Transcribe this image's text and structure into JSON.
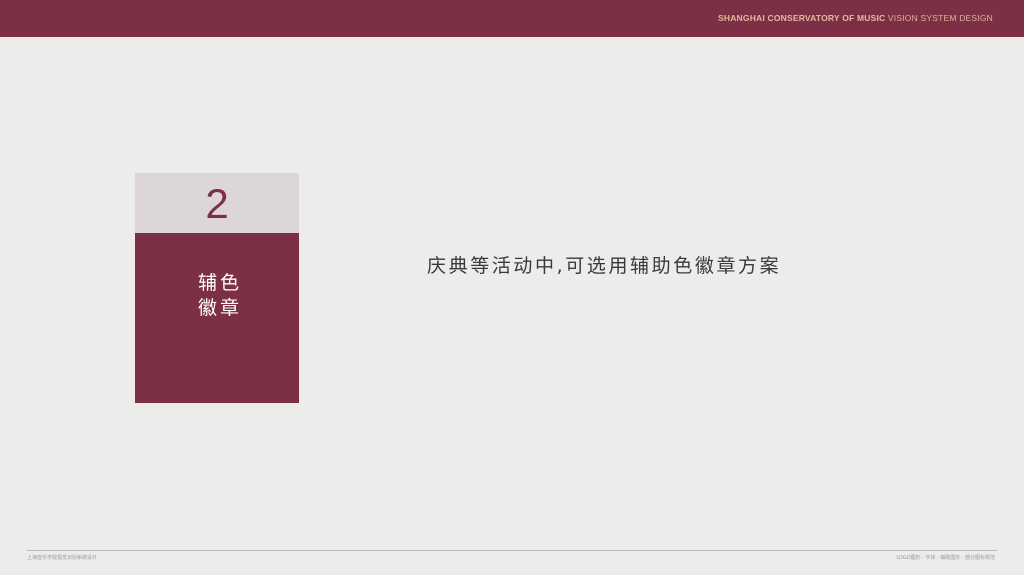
{
  "header": {
    "brand_primary": "SHANGHAI CONSERVATORY OF MUSIC",
    "brand_secondary": "VISION SYSTEM DESIGN"
  },
  "section": {
    "number": "2",
    "title_line1": "辅色",
    "title_line2": "徽章"
  },
  "main": {
    "text": "庆典等活动中,可选用辅助色徽章方案"
  },
  "footer": {
    "left": "上海音乐学院视觉识别系统设计",
    "right": "LOGO图形 · 字体 · 辅助图形 · 部分图标规范"
  },
  "colors": {
    "brand_maroon": "#7d2f45",
    "card_light": "#dcd6d8",
    "background": "#ececea",
    "brand_text": "#e6b89f"
  }
}
